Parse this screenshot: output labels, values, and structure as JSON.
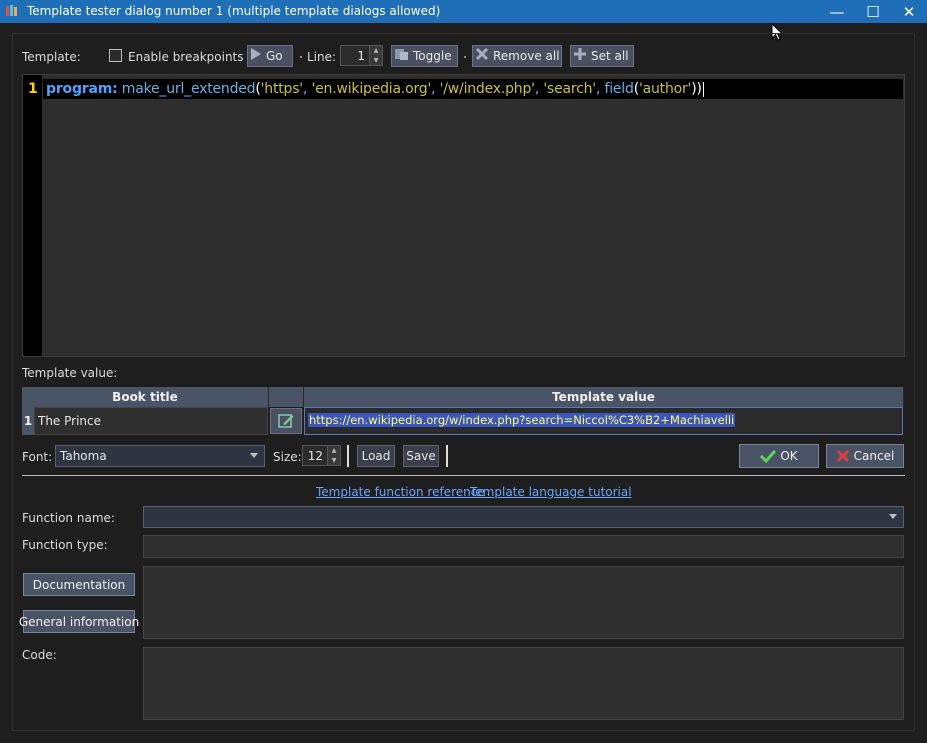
{
  "window": {
    "title": "Template tester dialog number 1 (multiple template dialogs allowed)",
    "minimize": "—",
    "maximize": "☐",
    "close": "✕"
  },
  "toolbar": {
    "template_label": "Template:",
    "enable_breakpoints": "Enable breakpoints",
    "go": "Go",
    "line_label": "Line:",
    "line_value": "1",
    "toggle": "Toggle",
    "remove_all": "Remove all",
    "set_all": "Set all"
  },
  "editor": {
    "line_number": "1",
    "tokens": {
      "keyword": "program:",
      "func1": "make_url_extended",
      "open1": "(",
      "s1": "'https'",
      "c1": ", ",
      "s2": "'en.wikipedia.org'",
      "c2": ", ",
      "s3": "'/w/index.php'",
      "c3": ", ",
      "s4": "'search'",
      "c4": ", ",
      "func2": "field",
      "open2": "(",
      "s5": "'author'",
      "close2": ")",
      "close1": ")"
    }
  },
  "results": {
    "label": "Template value:",
    "columns": [
      "Book title",
      "Template value"
    ],
    "rows": [
      {
        "num": "1",
        "title": "The Prince",
        "value": "https://en.wikipedia.org/w/index.php?search=Niccol%C3%B2+Machiavelli"
      }
    ]
  },
  "font_row": {
    "font_label": "Font:",
    "font_value": "Tahoma",
    "size_label": "Size:",
    "size_value": "12",
    "load": "Load",
    "save": "Save",
    "ok": "OK",
    "cancel": "Cancel"
  },
  "links": {
    "function_reference": "Template function reference",
    "language_tutorial": "Template language tutorial"
  },
  "function_panel": {
    "function_name_label": "Function name:",
    "function_type_label": "Function type:",
    "documentation": "Documentation",
    "general_information": "General information",
    "code_label": "Code:"
  },
  "colors": {
    "titlebar": "#1f6fb8",
    "background": "#1e1e1e",
    "keyword": "#4fa3ff",
    "string": "#c8c040",
    "link": "#6aa6ff",
    "selection": "#3a55c0"
  }
}
